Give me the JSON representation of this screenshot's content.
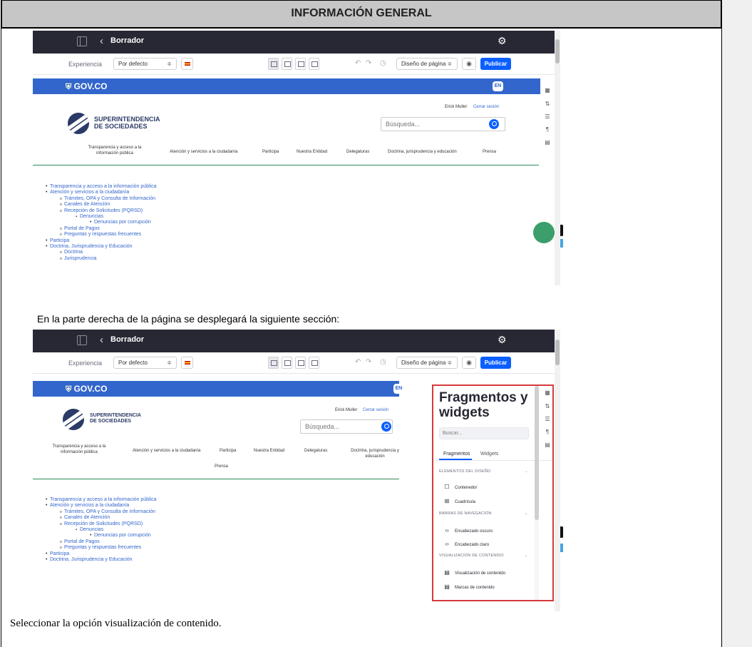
{
  "document": {
    "header": "INFORMACIÓN GENERAL",
    "caption_1": "En la parte derecha de la página se desplegará la siguiente sección:",
    "caption_2": "Seleccionar la opción visualización de contenido."
  },
  "editor": {
    "title": "Borrador",
    "experience_label": "Experiencia",
    "experience_value": "Por defecto",
    "design_select": "Diseño de página ≑",
    "publish": "Publicar"
  },
  "site": {
    "gov_logo": "GOV.CO",
    "en_button": "EN",
    "logo_line_1": "SUPERINTENDENCIA",
    "logo_line_2": "DE SOCIEDADES",
    "user_name": "Erick Muller",
    "logout": "Cerrar sesión",
    "search_placeholder": "Búsqueda...",
    "nav": [
      "Transparencia y acceso a la información pública",
      "Atención y servicios a la ciudadanía",
      "Participa",
      "Nuestra Entidad",
      "Delegaturas",
      "Doctrina, jurisprudencia y educación",
      "Prensa"
    ],
    "tree": {
      "transparencia": "Transparencia y acceso a la información pública",
      "atencion": "Atención y servicios a la ciudadanía",
      "tramites": "Trámites, OPA y Consulta de Información",
      "canales": "Canales de Atención",
      "recepcion": "Recepción de Solicitudes (PQRSD)",
      "denuncias": "Denuncias",
      "denuncias_corrupcion": "Denuncias por corrupción",
      "portal_pagos": "Portal de Pagos",
      "preguntas": "Preguntas y respuestas frecuentes",
      "participa": "Participa",
      "doctrina": "Doctrina, Jurisprudencia y Educación",
      "doctrina_sub": "Doctrina",
      "jurisprudencia": "Jurisprudencia"
    }
  },
  "fragments_panel": {
    "title": "Fragmentos y widgets",
    "search_placeholder": "Buscar...",
    "tab_fragments": "Fragmentos",
    "tab_widgets": "Widgets",
    "section_design": "ELEMENTOS DEL DISEÑO",
    "item_container": "Contenedor",
    "item_grid": "Cuadrícula",
    "section_nav": "BARRAS DE NAVEGACIÓN",
    "item_dark_header": "Encabezado oscuro",
    "item_light_header": "Encabezado claro",
    "section_content": "VISUALIZACIÓN DE CONTENIDO",
    "item_content_display": "Visualización de contenido",
    "item_content_marks": "Marcas de contenido"
  }
}
